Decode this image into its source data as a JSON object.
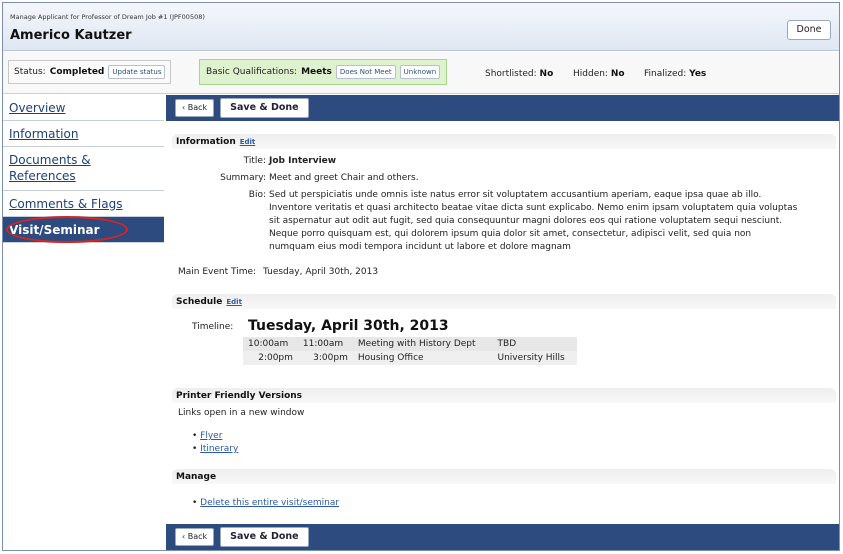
{
  "header": {
    "manage_line": "Manage Applicant for Professor of Dream Job #1 (JPF00508)",
    "applicant_name": "Americo Kautzer",
    "done_label": "Done"
  },
  "statusbar": {
    "status_label": "Status:",
    "status_value": "Completed",
    "update_status": "Update status",
    "quals_label": "Basic Qualifications:",
    "quals_value": "Meets",
    "does_not_meet": "Does Not Meet",
    "unknown": "Unknown",
    "shortlisted_label": "Shortlisted:",
    "shortlisted_value": "No",
    "hidden_label": "Hidden:",
    "hidden_value": "No",
    "finalized_label": "Finalized:",
    "finalized_value": "Yes"
  },
  "sidebar": {
    "items": [
      {
        "label": "Overview"
      },
      {
        "label": "Information"
      },
      {
        "label": "Documents & References"
      },
      {
        "label": "Comments & Flags"
      },
      {
        "label": "Visit/Seminar"
      }
    ]
  },
  "toolbar": {
    "back_label": "‹ Back",
    "save_done_label": "Save & Done"
  },
  "information": {
    "heading": "Information",
    "edit": "Edit",
    "title_label": "Title:",
    "title_value": "Job Interview",
    "summary_label": "Summary:",
    "summary_value": "Meet and greet Chair and others.",
    "bio_label": "Bio:",
    "bio_lines": [
      "Sed ut perspiciatis unde omnis iste natus error sit voluptatem accusantium aperiam, eaque ipsa quae ab illo.",
      "Inventore veritatis et quasi architecto beatae vitae dicta sunt explicabo. Nemo enim ipsam voluptatem quia voluptas",
      "sit aspernatur aut odit aut fugit, sed quia consequuntur magni dolores eos qui ratione voluptatem sequi nesciunt.",
      "Neque porro quisquam est, qui dolorem ipsum quia dolor sit amet, consectetur, adipisci velit, sed quia non",
      "numquam eius modi tempora incidunt ut labore et dolore magnam"
    ],
    "main_event_label": "Main Event Time:",
    "main_event_value": "Tuesday, April 30th, 2013"
  },
  "schedule": {
    "heading": "Schedule",
    "edit": "Edit",
    "timeline_label": "Timeline:",
    "timeline_date": "Tuesday, April 30th, 2013",
    "rows": [
      {
        "start": "10:00am",
        "end": "11:00am",
        "event": "Meeting with History Dept",
        "location": "TBD"
      },
      {
        "start": "2:00pm",
        "end": "3:00pm",
        "event": "Housing Office",
        "location": "University Hills"
      }
    ]
  },
  "printer": {
    "heading": "Printer Friendly Versions",
    "note": "Links open in a new window",
    "links": [
      "Flyer",
      "Itinerary"
    ]
  },
  "manage": {
    "heading": "Manage",
    "delete_link": "Delete this entire visit/seminar"
  },
  "colors": {
    "nav_blue": "#2e4b7f",
    "quals_green": "#dff2cf",
    "highlight_ring": "#d9241f"
  }
}
